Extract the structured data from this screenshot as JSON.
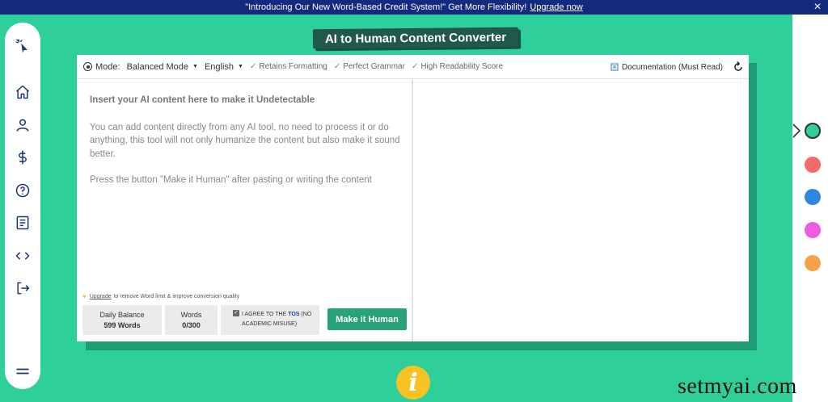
{
  "banner": {
    "text": "\"Introducing Our New Word-Based Credit System!\" Get More Flexibility!",
    "link": "Upgrade now",
    "close": "×"
  },
  "sidebar": {
    "icons": [
      "cursor-icon",
      "home-icon",
      "user-icon",
      "dollar-icon",
      "help-icon",
      "document-icon",
      "code-icon",
      "logout-icon",
      "menu-icon"
    ]
  },
  "title": "AI to Human Content Converter",
  "toolbar": {
    "mode_label": "Mode:",
    "mode_value": "Balanced Mode",
    "language": "English",
    "features": [
      "Retains Formatting",
      "Perfect Grammar",
      "High Readability Score"
    ],
    "documentation": "Documentation (Must Read)"
  },
  "editor": {
    "heading": "Insert your AI content here to make it Undetectable",
    "paragraph1": "You can add content directly from any AI tool, no need to process it or do anything, this tool will not only humanize the content but also make it sound better.",
    "paragraph2": "Press the button \"Make it Human\" after pasting or writing the content"
  },
  "footer": {
    "upgrade_link": "Upgrade",
    "upgrade_text": "to remove Word limit & improve conversion quality",
    "daily_balance_label": "Daily Balance",
    "daily_balance_value": "599 Words",
    "words_label": "Words",
    "words_value": "0/300",
    "agree_prefix": "I AGREE TO THE",
    "agree_tos": "TOS",
    "agree_suffix": "(NO ACADEMIC MISUSE)",
    "make_button": "Make it Human"
  },
  "theme_colors": [
    "#2ecf9b",
    "#f26b6b",
    "#2f86e0",
    "#ee5ce0",
    "#f7a04a"
  ],
  "info_icon": "i",
  "watermark": "setmyai.com"
}
